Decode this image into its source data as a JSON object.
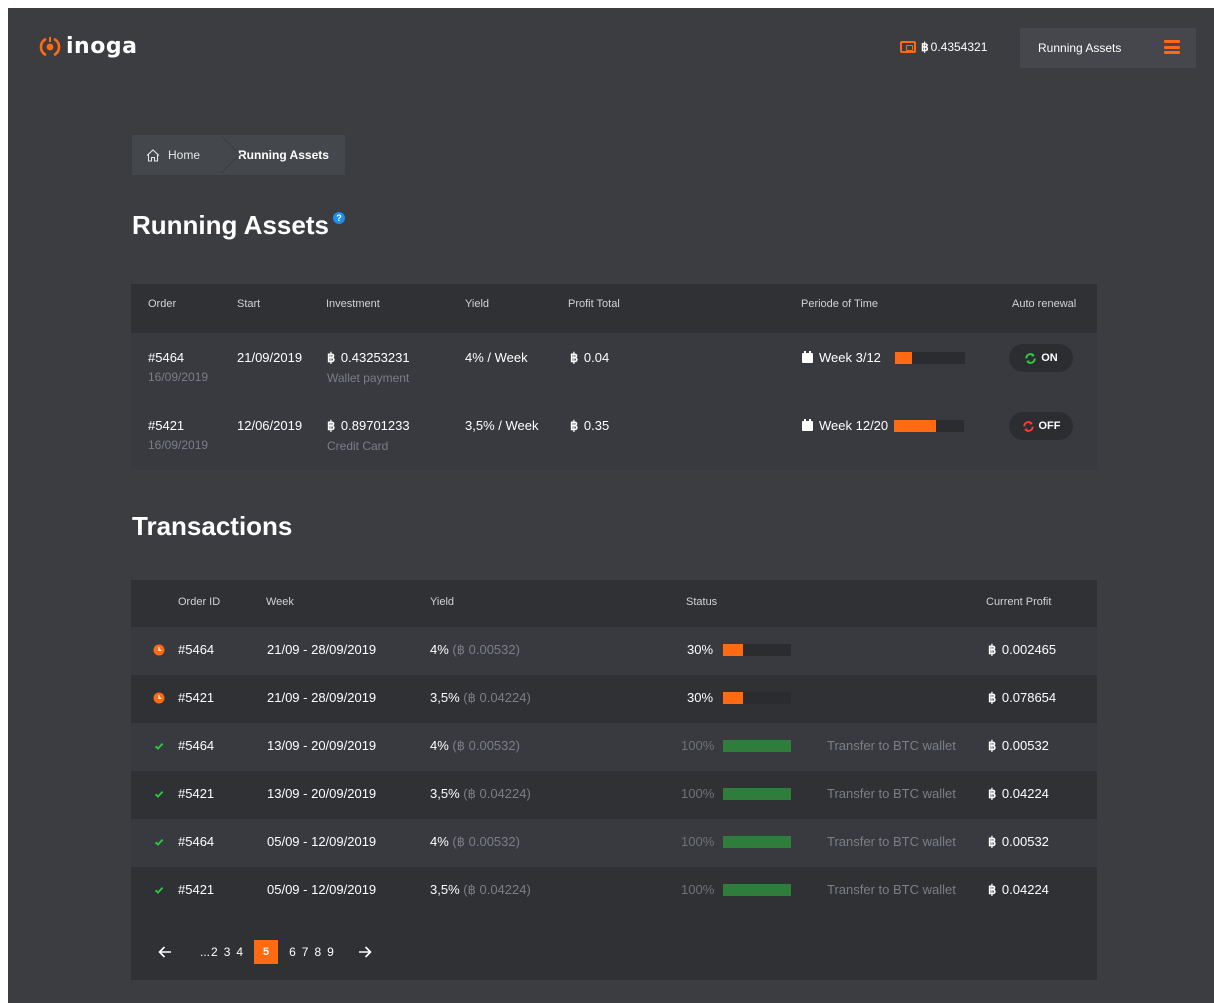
{
  "app": {
    "logo_text": "inoga"
  },
  "header": {
    "wallet_currency": "฿",
    "wallet_balance": "0.4354321",
    "nav_button_label": "Running Assets",
    "accent_color": "#ff6a13"
  },
  "breadcrumb": {
    "home_label": "Home",
    "current_label": "Running Assets"
  },
  "page_title": "Running Assets",
  "help_icon_label": "?",
  "assets": {
    "headers": [
      "Order",
      "Start",
      "Investment",
      "Yield",
      "Profit Total",
      "Periode of Time",
      "Auto renewal"
    ],
    "rows": [
      {
        "order": "#5464",
        "order_date": "16/09/2019",
        "start": "21/09/2019",
        "currency": "฿",
        "investment": "0.43253231",
        "payment": "Wallet payment",
        "yield": "4% / Week",
        "profit": "0.04",
        "week": "Week 3/12",
        "progress": 0.25,
        "renewal": "ON",
        "renewal_color": "#2ecc40"
      },
      {
        "order": "#5421",
        "order_date": "16/09/2019",
        "start": "12/06/2019",
        "currency": "฿",
        "investment": "0.89701233",
        "payment": "Credit Card",
        "yield": "3,5% / Week",
        "profit": "0.35",
        "week": "Week 12/20",
        "progress": 0.6,
        "renewal": "OFF",
        "renewal_color": "#ff3b30"
      }
    ]
  },
  "transactions_title": "Transactions",
  "transactions": {
    "headers": [
      "Order ID",
      "Week",
      "Yield",
      "Status",
      "Current Profit"
    ],
    "rows": [
      {
        "state": "pending",
        "order": "#5464",
        "week": "21/09 - 28/09/2019",
        "yield": "4%",
        "yield_btc": "(฿ 0.00532)",
        "status_pct": "30%",
        "progress": 0.3,
        "note": "",
        "profit": "0.002465"
      },
      {
        "state": "pending",
        "order": "#5421",
        "week": "21/09 - 28/09/2019",
        "yield": "3,5%",
        "yield_btc": "(฿ 0.04224)",
        "status_pct": "30%",
        "progress": 0.3,
        "note": "",
        "profit": "0.078654"
      },
      {
        "state": "done",
        "order": "#5464",
        "week": "13/09 - 20/09/2019",
        "yield": "4%",
        "yield_btc": "(฿ 0.00532)",
        "status_pct": "100%",
        "progress": 1,
        "note": "Transfer to BTC wallet",
        "profit": "0.00532"
      },
      {
        "state": "done",
        "order": "#5421",
        "week": "13/09 - 20/09/2019",
        "yield": "3,5%",
        "yield_btc": "(฿ 0.04224)",
        "status_pct": "100%",
        "progress": 1,
        "note": "Transfer to BTC wallet",
        "profit": "0.04224"
      },
      {
        "state": "done",
        "order": "#5464",
        "week": "05/09 - 12/09/2019",
        "yield": "4%",
        "yield_btc": "(฿ 0.00532)",
        "status_pct": "100%",
        "progress": 1,
        "note": "Transfer to BTC wallet",
        "profit": "0.00532"
      },
      {
        "state": "done",
        "order": "#5421",
        "week": "05/09 - 12/09/2019",
        "yield": "3,5%",
        "yield_btc": "(฿ 0.04224)",
        "status_pct": "100%",
        "progress": 1,
        "note": "Transfer to BTC wallet",
        "profit": "0.04224"
      }
    ]
  },
  "pagination": {
    "prev_icon": "arrow-left-icon",
    "next_icon": "arrow-right-icon",
    "ellipsis": "...",
    "pages_before": [
      "2",
      "3",
      "4"
    ],
    "current": "5",
    "pages_after": [
      "6",
      "7",
      "8",
      "9"
    ]
  },
  "colors": {
    "pending": "#ff6a13",
    "done": "#2ecc40",
    "done_bar": "#2e7d3a",
    "pending_bar": "#ff6a13"
  }
}
